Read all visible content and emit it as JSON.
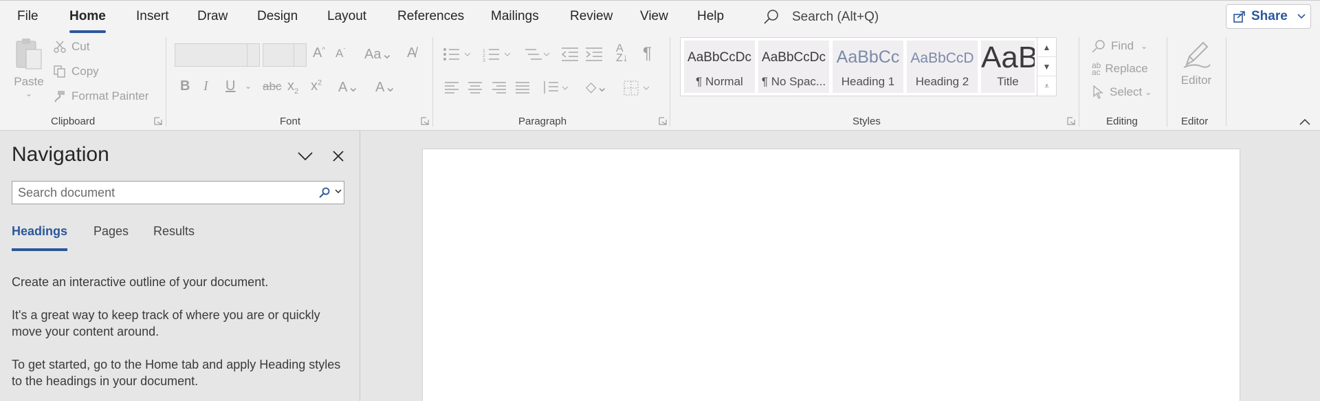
{
  "menu": {
    "tabs": [
      "File",
      "Home",
      "Insert",
      "Draw",
      "Design",
      "Layout",
      "References",
      "Mailings",
      "Review",
      "View",
      "Help"
    ],
    "active_tab": "Home",
    "search_placeholder": "Search (Alt+Q)",
    "share_label": "Share"
  },
  "ribbon": {
    "clipboard": {
      "label": "Clipboard",
      "paste": "Paste",
      "cut": "Cut",
      "copy": "Copy",
      "format_painter": "Format Painter"
    },
    "font": {
      "label": "Font"
    },
    "paragraph": {
      "label": "Paragraph"
    },
    "styles": {
      "label": "Styles",
      "items": [
        {
          "sample": "AaBbCcDc",
          "name": "¶ Normal"
        },
        {
          "sample": "AaBbCcDc",
          "name": "¶ No Spac..."
        },
        {
          "sample": "AaBbCc",
          "name": "Heading 1"
        },
        {
          "sample": "AaBbCcD",
          "name": "Heading 2"
        },
        {
          "sample": "AaB",
          "name": "Title"
        }
      ]
    },
    "editing": {
      "label": "Editing",
      "find": "Find",
      "replace": "Replace",
      "select": "Select"
    },
    "editor": {
      "label": "Editor",
      "button": "Editor"
    }
  },
  "navigation": {
    "title": "Navigation",
    "search_placeholder": "Search document",
    "tabs": [
      "Headings",
      "Pages",
      "Results"
    ],
    "active_tab": "Headings",
    "paragraphs": [
      "Create an interactive outline of your document.",
      "It's a great way to keep track of where you are or quickly move your content around.",
      "To get started, go to the Home tab and apply Heading styles to the headings in your document."
    ]
  },
  "colors": {
    "accent": "#2b579a",
    "ribbon_bg": "#f3f3f3",
    "pane_bg": "#e6e6e6"
  }
}
